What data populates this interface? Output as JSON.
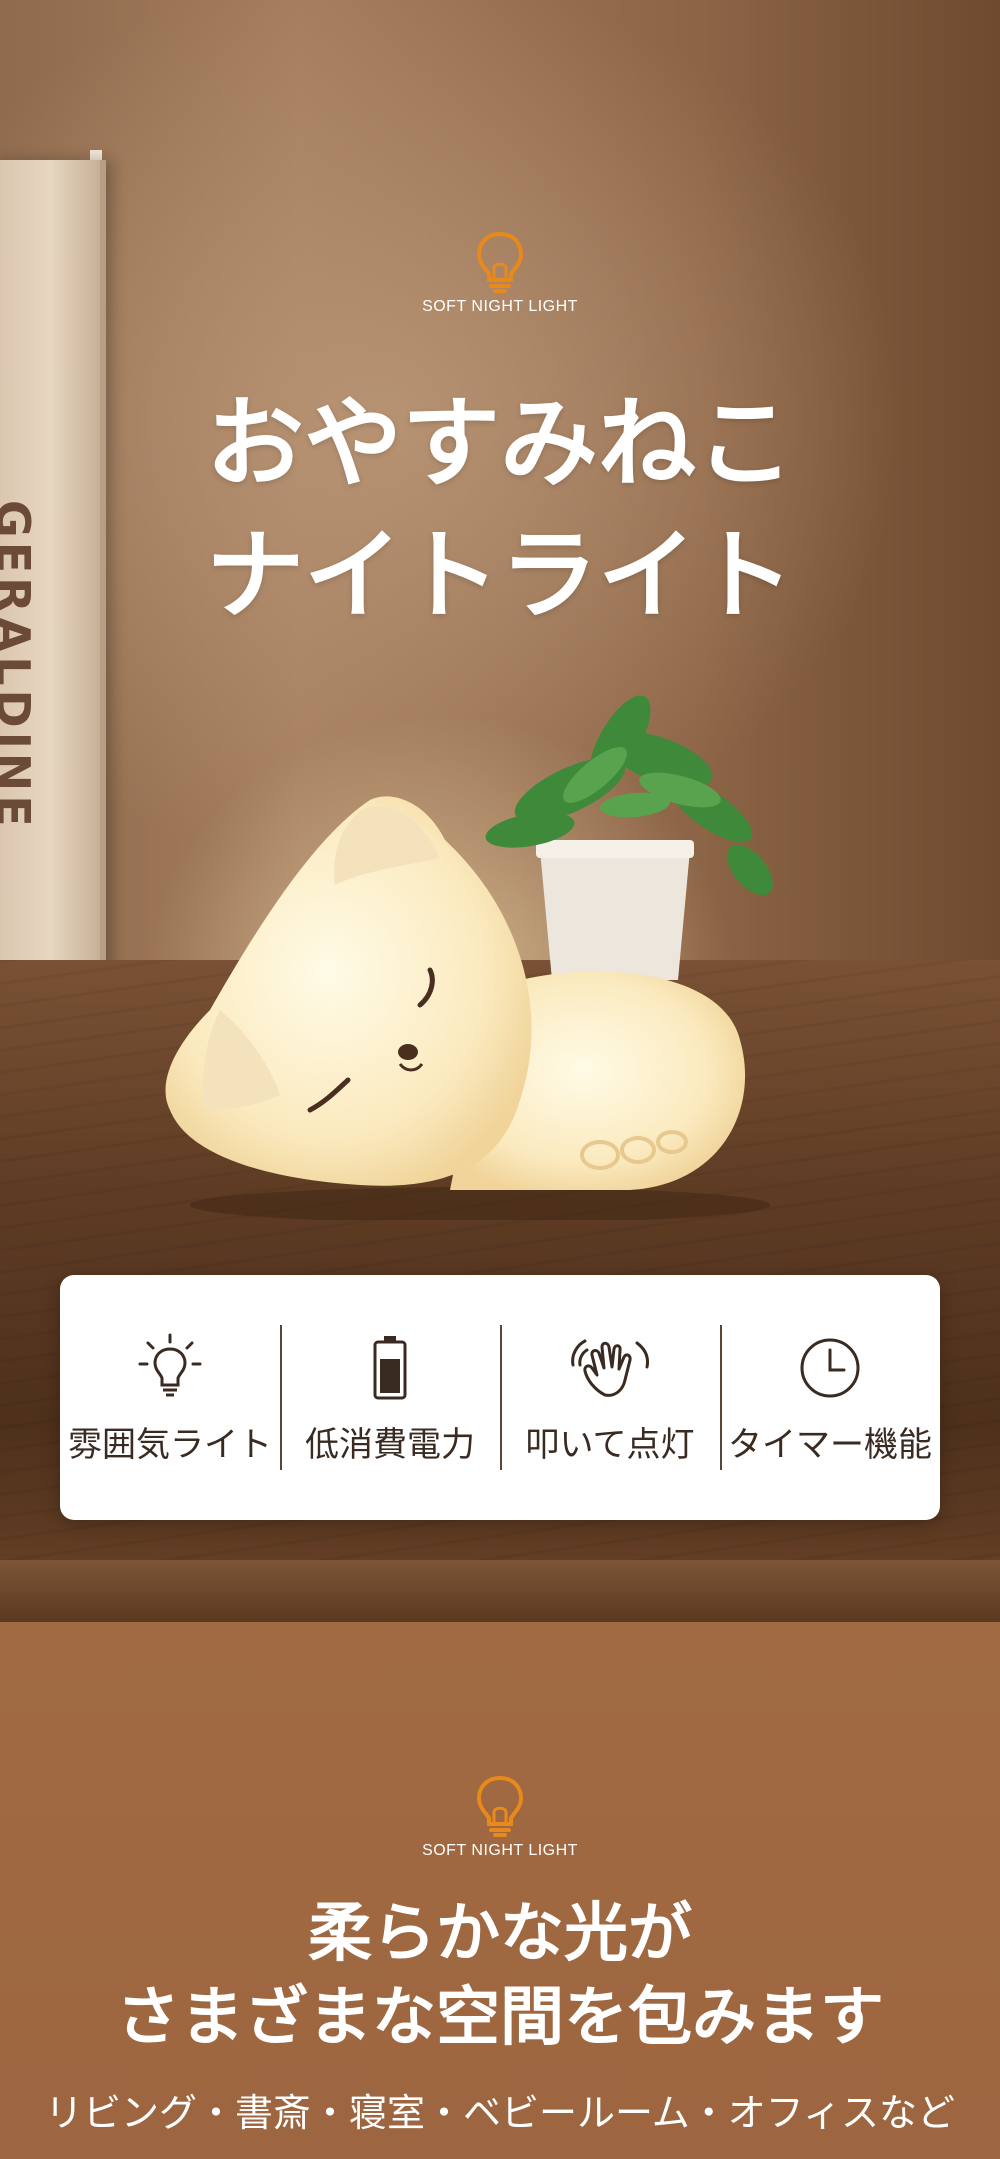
{
  "hero": {
    "badge_text": "SOFT NIGHT LIGHT",
    "title_line1": "おやすみねこ",
    "title_line2": "ナイトライト",
    "book_spine_text": "GERALDINE"
  },
  "features": [
    {
      "label": "雰囲気ライト",
      "icon": "bulb-glow-icon"
    },
    {
      "label": "低消費電力",
      "icon": "battery-icon"
    },
    {
      "label": "叩いて点灯",
      "icon": "tap-hand-icon"
    },
    {
      "label": "タイマー機能",
      "icon": "clock-icon"
    }
  ],
  "lower": {
    "badge_text": "SOFT NIGHT LIGHT",
    "title_line1": "柔らかな光が",
    "title_line2": "さまざまな空間を包みます",
    "subtitle": "リビング・書斎・寝室・ベビールーム・オフィスなど"
  },
  "colors": {
    "accent_orange": "#e8891c",
    "lower_bg": "#a16a42",
    "feature_text": "#3a2b22"
  }
}
